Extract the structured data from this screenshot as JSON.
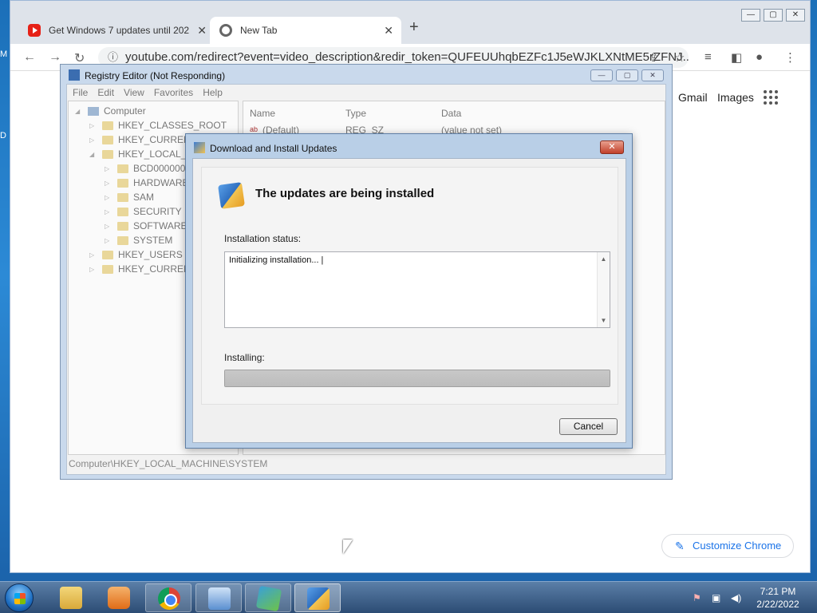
{
  "desktop": {
    "letters": [
      "M",
      "D"
    ]
  },
  "chrome": {
    "tabs": [
      {
        "title": "Get Windows 7 updates until 202",
        "icon": "youtube-icon"
      },
      {
        "title": "New Tab",
        "icon": "chrome-icon"
      }
    ],
    "url": "youtube.com/redirect?event=video_description&redir_token=QUFEUUhqbEZFc1J5eWJKLXNtME5rZFNJ...",
    "ntp_links": {
      "gmail": "Gmail",
      "images": "Images"
    },
    "customize_label": "Customize Chrome",
    "accent_color": "#1a73e8"
  },
  "regedit": {
    "title": "Registry Editor (Not Responding)",
    "menu": [
      "File",
      "Edit",
      "View",
      "Favorites",
      "Help"
    ],
    "tree": {
      "root": "Computer",
      "hives": [
        "HKEY_CLASSES_ROOT",
        "HKEY_CURRENT",
        "HKEY_LOCAL_M"
      ],
      "local_machine_children": [
        "BCD00000000",
        "HARDWARE",
        "SAM",
        "SECURITY",
        "SOFTWARE",
        "SYSTEM"
      ],
      "more_hives": [
        "HKEY_USERS",
        "HKEY_CURRENT"
      ]
    },
    "columns": {
      "name": "Name",
      "type": "Type",
      "data": "Data"
    },
    "row": {
      "name": "(Default)",
      "type": "REG_SZ",
      "data": "(value not set)"
    },
    "status_path": "Computer\\HKEY_LOCAL_MACHINE\\SYSTEM"
  },
  "dialog": {
    "title": "Download and Install Updates",
    "heading": "The updates are being installed",
    "status_label": "Installation status:",
    "status_text": "Initializing installation... |",
    "progress_label": "Installing:",
    "progress_fraction": 1.0,
    "cancel_label": "Cancel"
  },
  "taskbar": {
    "time": "7:21 PM",
    "date": "2/22/2022"
  }
}
